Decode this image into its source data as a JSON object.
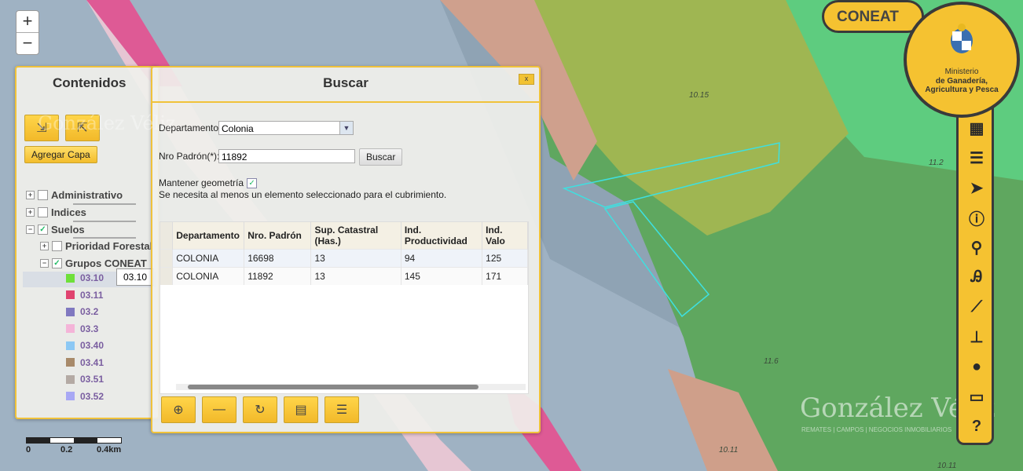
{
  "map": {
    "zoom_in": "+",
    "zoom_out": "−",
    "labels": [
      "10.15",
      "11.2",
      "11.6",
      "10.11",
      "10.11"
    ],
    "scale": {
      "ticks": [
        "0",
        "0.2",
        "0.4km"
      ]
    }
  },
  "contents_panel": {
    "title": "Contenidos",
    "add_layer": "Agregar Capa",
    "tree": {
      "administrativo": "Administrativo",
      "indices": "Indices",
      "suelos": "Suelos",
      "prioridad_forestal": "Prioridad Forestal",
      "grupos_coneat": "Grupos CONEAT"
    },
    "legend": [
      {
        "label": "03.10",
        "color": "#6ee03a"
      },
      {
        "label": "03.11",
        "color": "#e0436f"
      },
      {
        "label": "03.2",
        "color": "#8078c0"
      },
      {
        "label": "03.3",
        "color": "#f4b4d8"
      },
      {
        "label": "03.40",
        "color": "#8cc8f4"
      },
      {
        "label": "03.41",
        "color": "#a88a6a"
      },
      {
        "label": "03.51",
        "color": "#b4aaa4"
      },
      {
        "label": "03.52",
        "color": "#a8a8f4"
      }
    ],
    "tooltip": "03.10"
  },
  "search_panel": {
    "title": "Buscar",
    "close": "x",
    "department_label": "Departamento",
    "department_value": "Colonia",
    "padron_label": "Nro Padrón(*):",
    "padron_value": "11892",
    "search_button": "Buscar",
    "keep_geometry_label": "Mantener geometría",
    "hint": "Se necesita al menos un elemento seleccionado para el cubrimiento.",
    "columns": [
      "Departamento",
      "Nro. Padrón",
      "Sup. Catastral (Has.)",
      "Ind. Productividad",
      "Ind. Valo"
    ],
    "rows": [
      [
        "COLONIA",
        "16698",
        "13",
        "94",
        "125"
      ],
      [
        "COLONIA",
        "11892",
        "13",
        "145",
        "171"
      ]
    ]
  },
  "branding": {
    "coneat": "CONEAT",
    "ministry_line1": "Ministerio",
    "ministry_line2": "de Ganadería,",
    "ministry_line3": "Agricultura y Pesca",
    "watermark": "González Véliz",
    "watermark_sub": "REMATES | CAMPOS | NEGOCIOS INMOBILIARIOS",
    "watermark_small": "González Véliz"
  },
  "side_tools": [
    "grid-icon",
    "list-icon",
    "navigate-icon",
    "info-icon",
    "search-icon",
    "translate-icon",
    "ruler-icon",
    "pin-icon",
    "location-icon",
    "print-icon",
    "help-icon"
  ]
}
